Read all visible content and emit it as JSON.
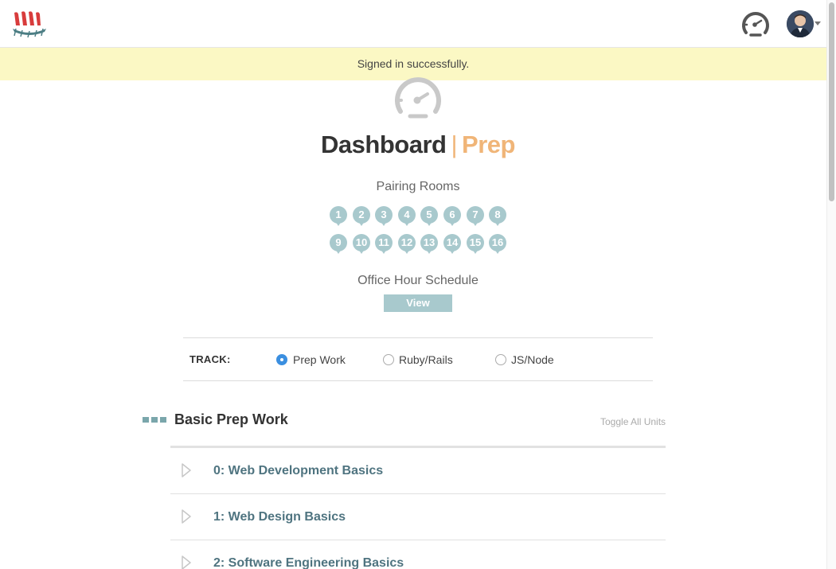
{
  "flash": {
    "message": "Signed in successfully."
  },
  "header": {
    "logo": "dev-bootcamp-longship-logo",
    "dashboard_icon": "speedometer-icon",
    "avatar": "user-avatar"
  },
  "hero": {
    "icon": "speedometer-icon",
    "title": "Dashboard",
    "separator": "|",
    "subtitle": "Prep"
  },
  "pairing": {
    "label": "Pairing Rooms",
    "rooms": [
      "1",
      "2",
      "3",
      "4",
      "5",
      "6",
      "7",
      "8",
      "9",
      "10",
      "11",
      "12",
      "13",
      "14",
      "15",
      "16"
    ]
  },
  "office_hours": {
    "label": "Office Hour Schedule",
    "button": "View"
  },
  "track": {
    "label": "TRACK:",
    "options": [
      {
        "label": "Prep Work",
        "checked": true
      },
      {
        "label": "Ruby/Rails",
        "checked": false
      },
      {
        "label": "JS/Node",
        "checked": false
      }
    ]
  },
  "section": {
    "title": "Basic Prep Work",
    "toggle": "Toggle All Units",
    "units": [
      {
        "title": "0: Web Development Basics"
      },
      {
        "title": "1: Web Design Basics"
      },
      {
        "title": "2: Software Engineering Basics"
      }
    ]
  },
  "colors": {
    "accent_orange": "#f0b578",
    "teal_badge": "#a8c9cd",
    "unit_link": "#4f7480",
    "flash_bg": "#fbf8c4",
    "radio_checked": "#3b8fe0"
  }
}
